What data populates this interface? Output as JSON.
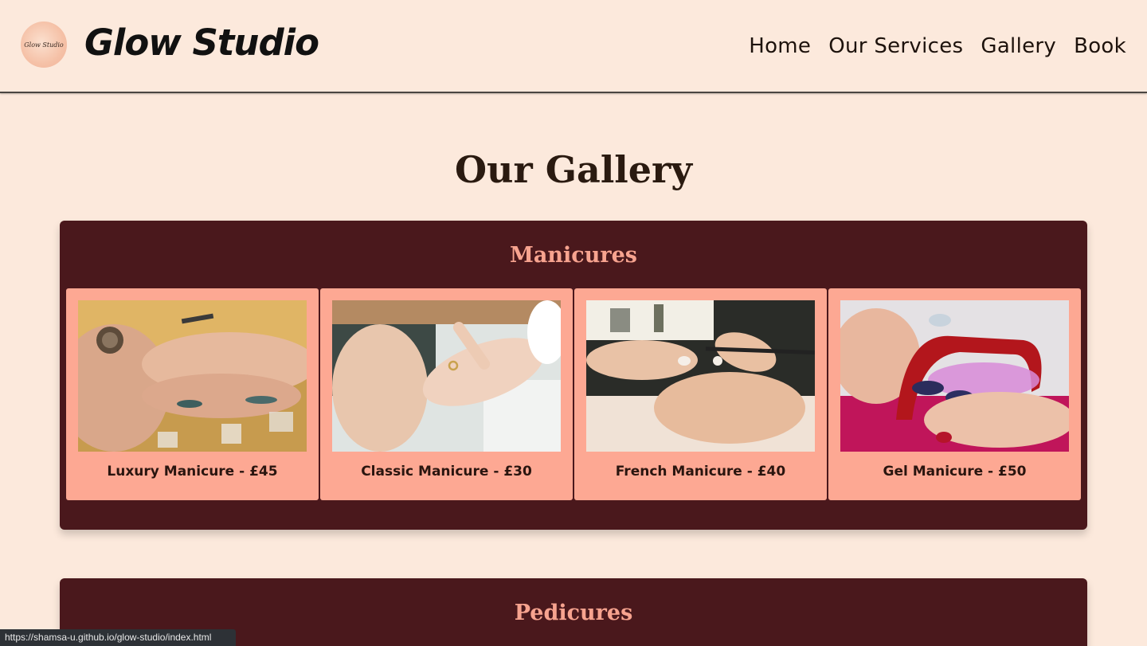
{
  "header": {
    "logo_text": "Glow Studio",
    "brand": "Glow Studio",
    "nav": [
      "Home",
      "Our Services",
      "Gallery",
      "Book"
    ]
  },
  "page_title": "Our Gallery",
  "sections": [
    {
      "title": "Manicures",
      "items": [
        {
          "caption": "Luxury Manicure - £45"
        },
        {
          "caption": "Classic Manicure - £30"
        },
        {
          "caption": "French Manicure - £40"
        },
        {
          "caption": "Gel Manicure - £50"
        }
      ]
    },
    {
      "title": "Pedicures",
      "items": []
    }
  ],
  "status_bar": {
    "url": "https://shamsa-u.github.io/glow-studio/index.html"
  },
  "colors": {
    "page_bg": "#fce9dc",
    "section_bg": "#4a181c",
    "card_bg": "#fda893",
    "section_title": "#f7a38f",
    "text_dark": "#1d120c"
  }
}
